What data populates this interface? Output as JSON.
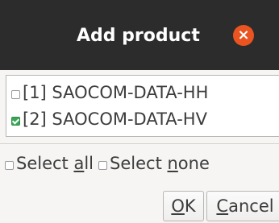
{
  "dialog": {
    "title": "Add product",
    "close_glyph": "×"
  },
  "list": {
    "items": [
      {
        "label": "[1] SAOCOM-DATA-HH",
        "checked": false
      },
      {
        "label": "[2] SAOCOM-DATA-HV",
        "checked": true
      }
    ]
  },
  "selection": {
    "select_all_prefix": "Select ",
    "select_all_mnemonic": "a",
    "select_all_suffix": "ll",
    "select_none_prefix": "Select ",
    "select_none_mnemonic": "n",
    "select_none_suffix": "one"
  },
  "buttons": {
    "ok_mnemonic": "O",
    "ok_rest": "K",
    "cancel_mnemonic": "C",
    "cancel_rest": "ancel"
  },
  "colors": {
    "titlebar": "#2c2c2c",
    "close_button": "#e95420",
    "checkbox_checked": "#3aa757"
  }
}
